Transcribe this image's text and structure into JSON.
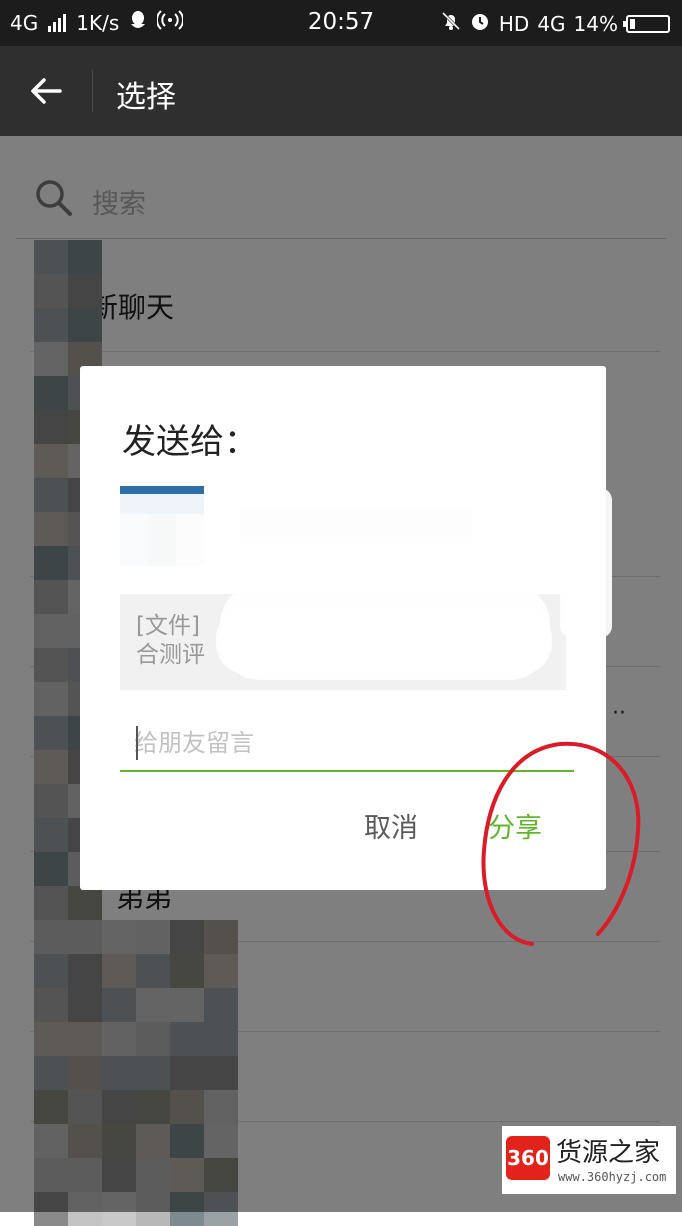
{
  "status_bar": {
    "network": "4G",
    "speed": "1K/s",
    "time": "20:57",
    "hd": "HD",
    "network2": "4G",
    "battery": "14%",
    "battery_level": 0.14
  },
  "header": {
    "back_icon": "arrow-left-icon",
    "title": "选择"
  },
  "search": {
    "placeholder": "搜索",
    "icon": "search-icon"
  },
  "list": {
    "new_chat_label": "新聊天",
    "partial_name": "弟弟",
    "ellipsis": "··"
  },
  "dialog": {
    "title": "发送给：",
    "preview_line1": "[文件]",
    "preview_line2": "合测评",
    "message_placeholder": "给朋友留言",
    "cancel_label": "取消",
    "share_label": "分享",
    "accent_color": "#62b62d"
  },
  "watermark": {
    "logo": "360",
    "brand": "货源之家",
    "url": "www.360hyzj.com"
  }
}
